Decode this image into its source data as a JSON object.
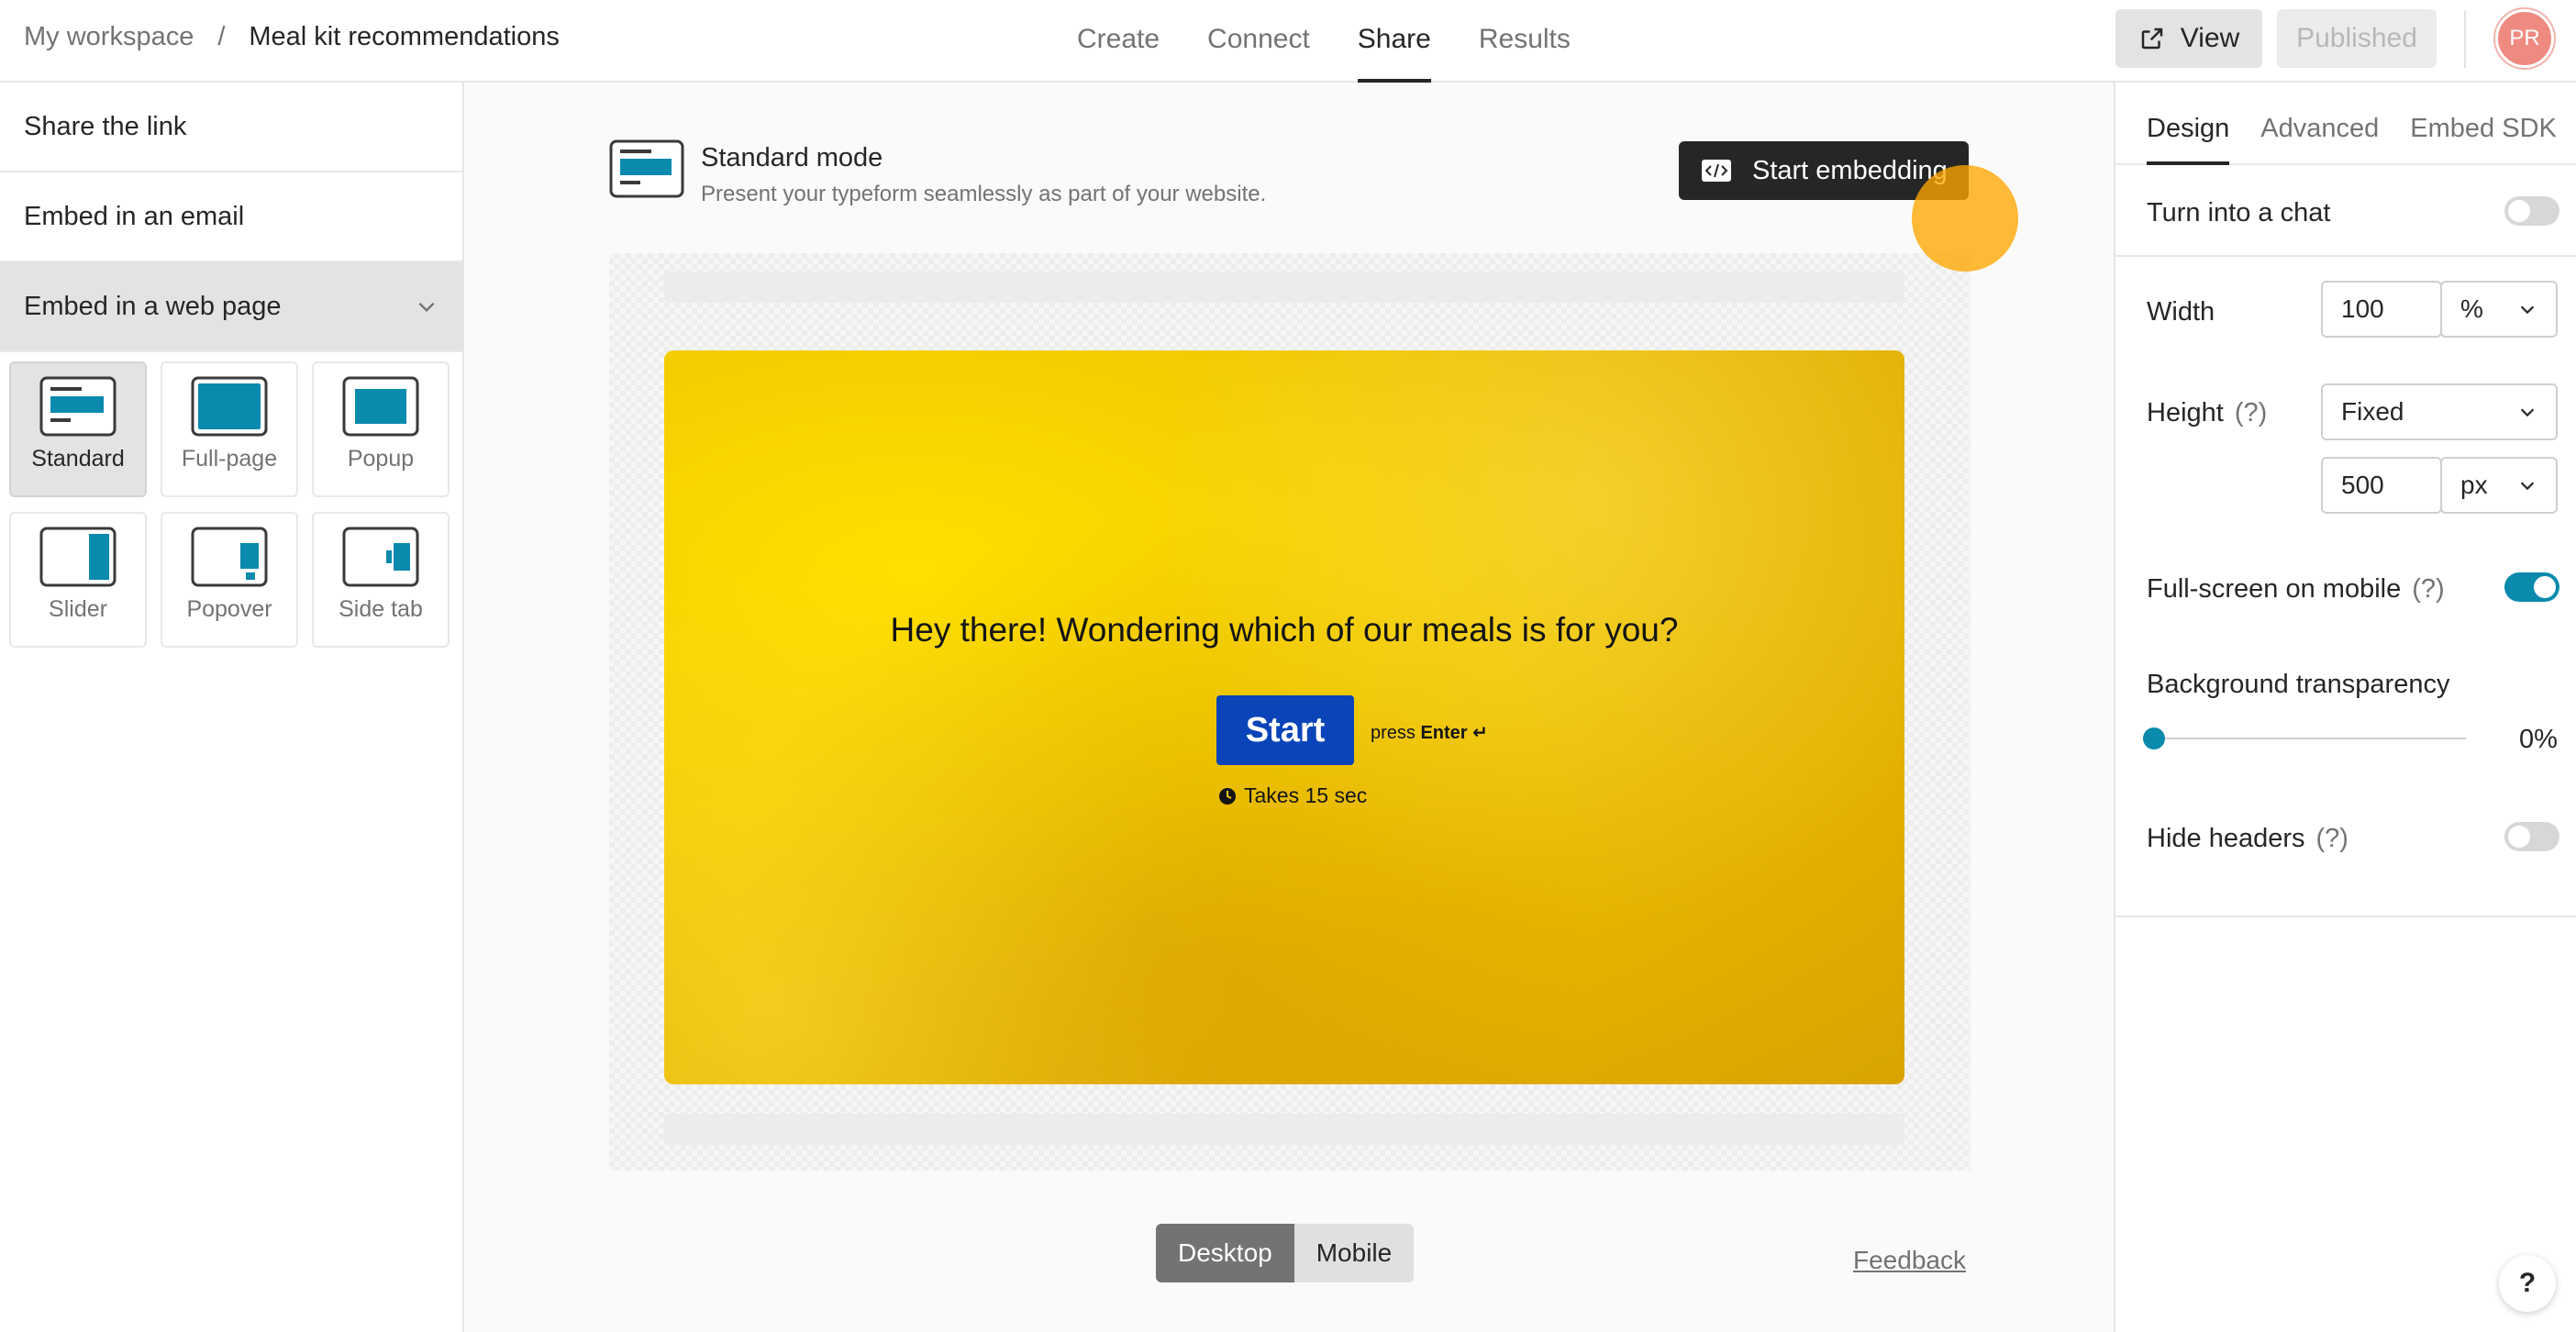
{
  "breadcrumb": {
    "workspace": "My workspace",
    "separator": "/",
    "form": "Meal kit recommendations"
  },
  "nav": {
    "tabs": [
      "Create",
      "Connect",
      "Share",
      "Results"
    ],
    "active": "Share"
  },
  "header": {
    "view_label": "View",
    "published_label": "Published",
    "avatar_initials": "PR"
  },
  "left": {
    "items": [
      "Share the link",
      "Embed in an email",
      "Embed in a web page"
    ],
    "modes": [
      "Standard",
      "Full-page",
      "Popup",
      "Slider",
      "Popover",
      "Side tab"
    ],
    "selected_mode": "Standard"
  },
  "center": {
    "mode_title": "Standard mode",
    "mode_subtitle": "Present your typeform seamlessly as part of your website.",
    "embed_button": "Start embedding",
    "form_question": "Hey there! Wondering which of our meals is for you?",
    "start_label": "Start",
    "press_text": "press",
    "enter_text": "Enter ↵",
    "takes_text": "Takes 15 sec",
    "device": {
      "desktop": "Desktop",
      "mobile": "Mobile",
      "selected": "Desktop"
    },
    "feedback": "Feedback"
  },
  "right": {
    "tabs": [
      "Design",
      "Advanced",
      "Embed SDK"
    ],
    "active_tab": "Design",
    "chat_label": "Turn into a chat",
    "chat_on": false,
    "width_label": "Width",
    "width_value": "100",
    "width_unit": "%",
    "height_label": "Height",
    "height_help": "(?)",
    "height_mode": "Fixed",
    "height_value": "500",
    "height_unit": "px",
    "fullscreen_label": "Full-screen on mobile",
    "fullscreen_help": "(?)",
    "fullscreen_on": true,
    "transparency_label": "Background transparency",
    "transparency_value": "0%",
    "transparency_fraction": 0,
    "hide_headers_label": "Hide headers",
    "hide_headers_help": "(?)",
    "hide_headers_on": false
  },
  "help_label": "?",
  "colors": {
    "accent": "#0a8aad",
    "start_button": "#0a44b8",
    "form_bg": "#f4cc00",
    "cursor": "#ffa600"
  }
}
